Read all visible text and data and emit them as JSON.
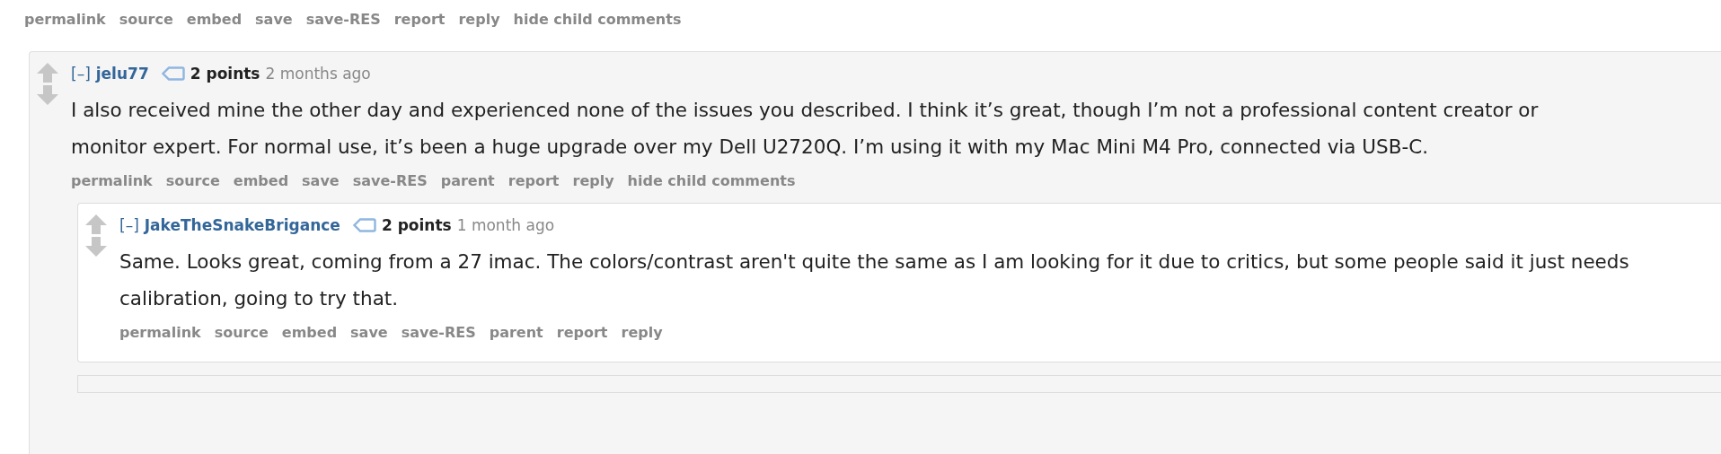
{
  "top_actions": [
    {
      "label": "permalink"
    },
    {
      "label": "source"
    },
    {
      "label": "embed"
    },
    {
      "label": "save"
    },
    {
      "label": "save-RES"
    },
    {
      "label": "report"
    },
    {
      "label": "reply"
    },
    {
      "label": "hide child comments"
    }
  ],
  "comments": [
    {
      "toggle": "[–]",
      "author": "jelu77",
      "score": "2 points",
      "time": "2 months ago",
      "body": "I also received mine the other day and experienced none of the issues you described. I think it’s great, though I’m not a professional content creator or monitor expert. For normal use, it’s been a huge upgrade over my Dell U2720Q. I’m using it with my Mac Mini M4 Pro, connected via USB-C.",
      "actions": [
        {
          "label": "permalink"
        },
        {
          "label": "source"
        },
        {
          "label": "embed"
        },
        {
          "label": "save"
        },
        {
          "label": "save-RES"
        },
        {
          "label": "parent"
        },
        {
          "label": "report"
        },
        {
          "label": "reply"
        },
        {
          "label": "hide child comments"
        }
      ],
      "children": [
        {
          "toggle": "[–]",
          "author": "JakeTheSnakeBrigance",
          "score": "2 points",
          "time": "1 month ago",
          "body": "Same. Looks great, coming from a 27 imac. The colors/contrast aren't quite the same as I am looking for it due to critics, but some people said it just needs calibration, going to try that.",
          "actions": [
            {
              "label": "permalink"
            },
            {
              "label": "source"
            },
            {
              "label": "embed"
            },
            {
              "label": "save"
            },
            {
              "label": "save-RES"
            },
            {
              "label": "parent"
            },
            {
              "label": "report"
            },
            {
              "label": "reply"
            }
          ]
        }
      ]
    }
  ]
}
